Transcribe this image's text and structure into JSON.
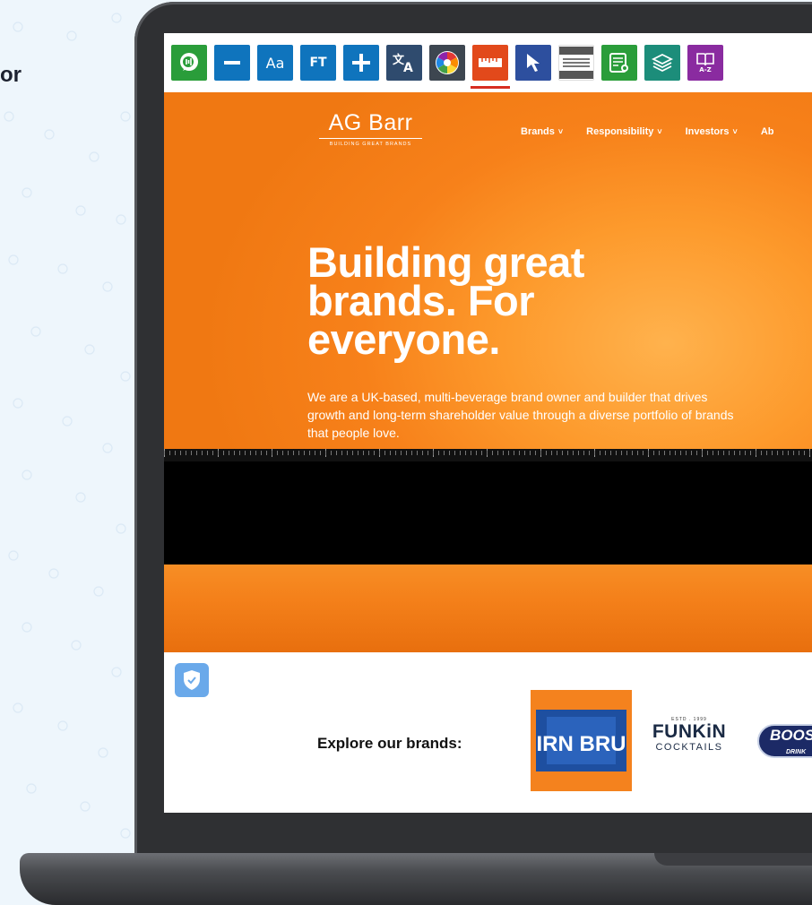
{
  "side_text": "or",
  "toolbar": {
    "buttons": [
      {
        "name": "speech-icon",
        "label": "",
        "color": "#2a9d3a"
      },
      {
        "name": "minus-icon",
        "label": "",
        "color": "#0f74bd"
      },
      {
        "name": "font-size-icon",
        "label": "Aa",
        "color": "#0f74bd"
      },
      {
        "name": "font-type-icon",
        "label": "FT",
        "color": "#0f74bd"
      },
      {
        "name": "plus-icon",
        "label": "",
        "color": "#0f74bd"
      },
      {
        "name": "translate-icon",
        "label": "",
        "color": "#2f4b6e"
      },
      {
        "name": "color-wheel-icon",
        "label": "",
        "color": "#3d4650"
      },
      {
        "name": "ruler-icon",
        "label": "",
        "color": "#e2491b"
      },
      {
        "name": "cursor-icon",
        "label": "",
        "color": "#2d4f9e"
      },
      {
        "name": "screen-mask-icon",
        "label": "",
        "color": "#565656"
      },
      {
        "name": "reader-icon",
        "label": "",
        "color": "#2a9d3a"
      },
      {
        "name": "layers-icon",
        "label": "",
        "color": "#1c8d7a"
      },
      {
        "name": "dictionary-icon",
        "label": "A-Z",
        "color": "#8a2ba0"
      }
    ]
  },
  "site": {
    "logo_main": "AG Barr",
    "logo_sub": "BUILDING GREAT BRANDS",
    "nav": [
      "Brands",
      "Responsibility",
      "Investors",
      "Ab"
    ],
    "headline": [
      "Building great",
      "brands. For",
      "everyone."
    ],
    "subtext": "We are a UK-based, multi-beverage brand owner and builder that drives growth and long-term shareholder value through a diverse portfolio of brands that people love.",
    "explore_label": "Explore our brands:",
    "brands": {
      "irn_bru": "IRN BRU",
      "funkin_top": "ESTD . 1999",
      "funkin_main": "FUNKiN",
      "funkin_sub": "COCKTAILS",
      "boost_main": "BOOS",
      "boost_sub": "DRINK"
    }
  },
  "colors": {
    "hero_orange": "#f7811a",
    "accent_red": "#d72d20",
    "shield_blue": "#6aa9ea"
  }
}
